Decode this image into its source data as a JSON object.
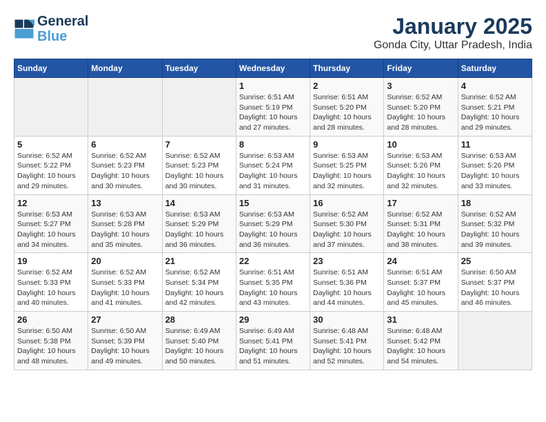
{
  "header": {
    "logo_line1": "General",
    "logo_line2": "Blue",
    "month": "January 2025",
    "location": "Gonda City, Uttar Pradesh, India"
  },
  "weekdays": [
    "Sunday",
    "Monday",
    "Tuesday",
    "Wednesday",
    "Thursday",
    "Friday",
    "Saturday"
  ],
  "weeks": [
    [
      {
        "day": "",
        "sunrise": "",
        "sunset": "",
        "daylight": ""
      },
      {
        "day": "",
        "sunrise": "",
        "sunset": "",
        "daylight": ""
      },
      {
        "day": "",
        "sunrise": "",
        "sunset": "",
        "daylight": ""
      },
      {
        "day": "1",
        "sunrise": "Sunrise: 6:51 AM",
        "sunset": "Sunset: 5:19 PM",
        "daylight": "Daylight: 10 hours and 27 minutes."
      },
      {
        "day": "2",
        "sunrise": "Sunrise: 6:51 AM",
        "sunset": "Sunset: 5:20 PM",
        "daylight": "Daylight: 10 hours and 28 minutes."
      },
      {
        "day": "3",
        "sunrise": "Sunrise: 6:52 AM",
        "sunset": "Sunset: 5:20 PM",
        "daylight": "Daylight: 10 hours and 28 minutes."
      },
      {
        "day": "4",
        "sunrise": "Sunrise: 6:52 AM",
        "sunset": "Sunset: 5:21 PM",
        "daylight": "Daylight: 10 hours and 29 minutes."
      }
    ],
    [
      {
        "day": "5",
        "sunrise": "Sunrise: 6:52 AM",
        "sunset": "Sunset: 5:22 PM",
        "daylight": "Daylight: 10 hours and 29 minutes."
      },
      {
        "day": "6",
        "sunrise": "Sunrise: 6:52 AM",
        "sunset": "Sunset: 5:23 PM",
        "daylight": "Daylight: 10 hours and 30 minutes."
      },
      {
        "day": "7",
        "sunrise": "Sunrise: 6:52 AM",
        "sunset": "Sunset: 5:23 PM",
        "daylight": "Daylight: 10 hours and 30 minutes."
      },
      {
        "day": "8",
        "sunrise": "Sunrise: 6:53 AM",
        "sunset": "Sunset: 5:24 PM",
        "daylight": "Daylight: 10 hours and 31 minutes."
      },
      {
        "day": "9",
        "sunrise": "Sunrise: 6:53 AM",
        "sunset": "Sunset: 5:25 PM",
        "daylight": "Daylight: 10 hours and 32 minutes."
      },
      {
        "day": "10",
        "sunrise": "Sunrise: 6:53 AM",
        "sunset": "Sunset: 5:26 PM",
        "daylight": "Daylight: 10 hours and 32 minutes."
      },
      {
        "day": "11",
        "sunrise": "Sunrise: 6:53 AM",
        "sunset": "Sunset: 5:26 PM",
        "daylight": "Daylight: 10 hours and 33 minutes."
      }
    ],
    [
      {
        "day": "12",
        "sunrise": "Sunrise: 6:53 AM",
        "sunset": "Sunset: 5:27 PM",
        "daylight": "Daylight: 10 hours and 34 minutes."
      },
      {
        "day": "13",
        "sunrise": "Sunrise: 6:53 AM",
        "sunset": "Sunset: 5:28 PM",
        "daylight": "Daylight: 10 hours and 35 minutes."
      },
      {
        "day": "14",
        "sunrise": "Sunrise: 6:53 AM",
        "sunset": "Sunset: 5:29 PM",
        "daylight": "Daylight: 10 hours and 36 minutes."
      },
      {
        "day": "15",
        "sunrise": "Sunrise: 6:53 AM",
        "sunset": "Sunset: 5:29 PM",
        "daylight": "Daylight: 10 hours and 36 minutes."
      },
      {
        "day": "16",
        "sunrise": "Sunrise: 6:52 AM",
        "sunset": "Sunset: 5:30 PM",
        "daylight": "Daylight: 10 hours and 37 minutes."
      },
      {
        "day": "17",
        "sunrise": "Sunrise: 6:52 AM",
        "sunset": "Sunset: 5:31 PM",
        "daylight": "Daylight: 10 hours and 38 minutes."
      },
      {
        "day": "18",
        "sunrise": "Sunrise: 6:52 AM",
        "sunset": "Sunset: 5:32 PM",
        "daylight": "Daylight: 10 hours and 39 minutes."
      }
    ],
    [
      {
        "day": "19",
        "sunrise": "Sunrise: 6:52 AM",
        "sunset": "Sunset: 5:33 PM",
        "daylight": "Daylight: 10 hours and 40 minutes."
      },
      {
        "day": "20",
        "sunrise": "Sunrise: 6:52 AM",
        "sunset": "Sunset: 5:33 PM",
        "daylight": "Daylight: 10 hours and 41 minutes."
      },
      {
        "day": "21",
        "sunrise": "Sunrise: 6:52 AM",
        "sunset": "Sunset: 5:34 PM",
        "daylight": "Daylight: 10 hours and 42 minutes."
      },
      {
        "day": "22",
        "sunrise": "Sunrise: 6:51 AM",
        "sunset": "Sunset: 5:35 PM",
        "daylight": "Daylight: 10 hours and 43 minutes."
      },
      {
        "day": "23",
        "sunrise": "Sunrise: 6:51 AM",
        "sunset": "Sunset: 5:36 PM",
        "daylight": "Daylight: 10 hours and 44 minutes."
      },
      {
        "day": "24",
        "sunrise": "Sunrise: 6:51 AM",
        "sunset": "Sunset: 5:37 PM",
        "daylight": "Daylight: 10 hours and 45 minutes."
      },
      {
        "day": "25",
        "sunrise": "Sunrise: 6:50 AM",
        "sunset": "Sunset: 5:37 PM",
        "daylight": "Daylight: 10 hours and 46 minutes."
      }
    ],
    [
      {
        "day": "26",
        "sunrise": "Sunrise: 6:50 AM",
        "sunset": "Sunset: 5:38 PM",
        "daylight": "Daylight: 10 hours and 48 minutes."
      },
      {
        "day": "27",
        "sunrise": "Sunrise: 6:50 AM",
        "sunset": "Sunset: 5:39 PM",
        "daylight": "Daylight: 10 hours and 49 minutes."
      },
      {
        "day": "28",
        "sunrise": "Sunrise: 6:49 AM",
        "sunset": "Sunset: 5:40 PM",
        "daylight": "Daylight: 10 hours and 50 minutes."
      },
      {
        "day": "29",
        "sunrise": "Sunrise: 6:49 AM",
        "sunset": "Sunset: 5:41 PM",
        "daylight": "Daylight: 10 hours and 51 minutes."
      },
      {
        "day": "30",
        "sunrise": "Sunrise: 6:48 AM",
        "sunset": "Sunset: 5:41 PM",
        "daylight": "Daylight: 10 hours and 52 minutes."
      },
      {
        "day": "31",
        "sunrise": "Sunrise: 6:48 AM",
        "sunset": "Sunset: 5:42 PM",
        "daylight": "Daylight: 10 hours and 54 minutes."
      },
      {
        "day": "",
        "sunrise": "",
        "sunset": "",
        "daylight": ""
      }
    ]
  ]
}
